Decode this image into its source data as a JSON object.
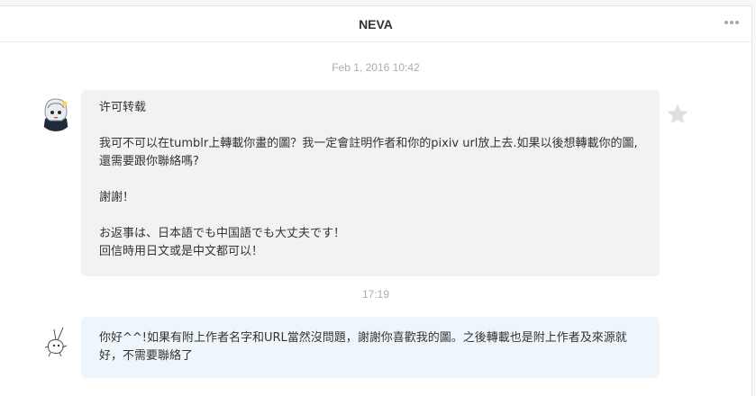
{
  "conversation": {
    "title": "NEVA",
    "more_icon": "ellipsis-icon"
  },
  "messages": [
    {
      "timestamp": "Feb 1, 2016 10:42",
      "sender": "other",
      "avatar": "anime-girl-avatar",
      "paragraphs": [
        "许可转载",
        "我可不可以在tumblr上轉載你畫的圖？我一定會註明作者和你的pixiv url放上去.如果以後想轉載你的圖,還需要跟你聯絡嗎?",
        "謝謝！",
        "お返事は、日本語でも中国語でも大丈夫です！\n回信時用日文或是中文都可以！"
      ],
      "action_icon": "star-icon"
    },
    {
      "timestamp": "17:19",
      "sender": "me",
      "avatar": "sketch-character-avatar",
      "paragraphs": [
        "你好^^!如果有附上作者名字和URL當然沒問題，謝謝你喜歡我的圖。之後轉載也是附上作者及來源就好，不需要聯絡了"
      ]
    }
  ],
  "colors": {
    "incoming_bubble": "#f2f2f2",
    "outgoing_bubble": "#eef6fb",
    "timestamp": "#adadad",
    "text": "#333333"
  }
}
